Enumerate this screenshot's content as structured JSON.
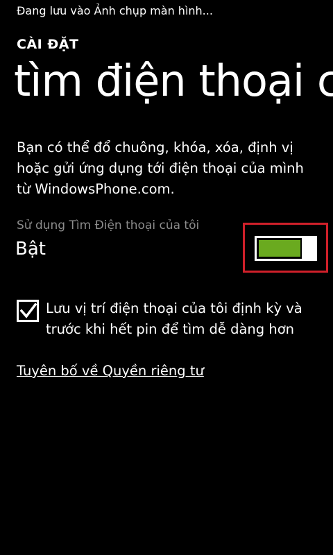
{
  "status_bar": {
    "text": "Đang lưu vào Ảnh chụp màn hình..."
  },
  "header": {
    "app_title": "CÀI ĐẶT",
    "page_title": "tìm điện thoại c"
  },
  "main": {
    "description": "Bạn có thể đổ chuông, khóa, xóa, định vị hoặc gửi ứng dụng tới điện thoại của mình từ WindowsPhone.com.",
    "toggle": {
      "caption": "Sử dụng Tìm Điện thoại của tôi",
      "state_label": "Bật",
      "on": true,
      "accent_color": "#6aaa1f",
      "highlight_color": "#d0202a"
    },
    "checkbox": {
      "checked": true,
      "label": "Lưu vị trí điện thoại của tôi định kỳ và trước khi hết pin để tìm dễ dàng hơn"
    },
    "privacy_link": "Tuyên bố về Quyền riêng tư"
  }
}
